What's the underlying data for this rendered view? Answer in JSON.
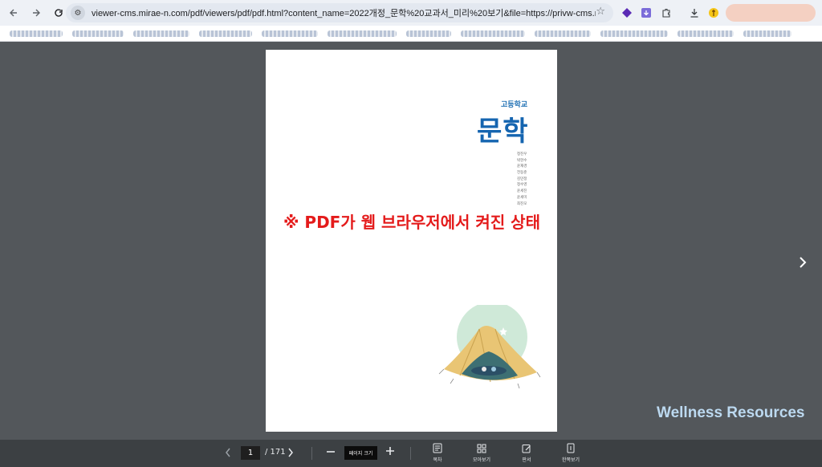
{
  "browser": {
    "url": "viewer-cms.mirae-n.com/pdf/viewers/pdf/pdf.html?content_name=2022개정_문학%20교과서_미리%20보기&file=https://privw-cms.mirae-n.com/do...",
    "back_icon": "arrow-left",
    "forward_icon": "arrow-right",
    "reload_icon": "reload"
  },
  "document": {
    "school_level": "고등학교",
    "subject": "문학",
    "authors": [
      "정진우",
      "박현수",
      "윤재경",
      "전동준",
      "김민정",
      "정수영",
      "윤세진",
      "윤세미",
      "최진모"
    ],
    "notice": "※ PDF가 웹 브라우저에서 켜진 상태"
  },
  "watermark": "Wellness Resources",
  "toolbar": {
    "current_page": "1",
    "total_pages": "/ 171",
    "zoom_label": "페이지 크기",
    "tools": [
      {
        "label": "목차",
        "icon": "toc-icon"
      },
      {
        "label": "모아보기",
        "icon": "grid-icon"
      },
      {
        "label": "판서",
        "icon": "pen-icon"
      },
      {
        "label": "한쪽보기",
        "icon": "single-page-icon"
      }
    ]
  }
}
